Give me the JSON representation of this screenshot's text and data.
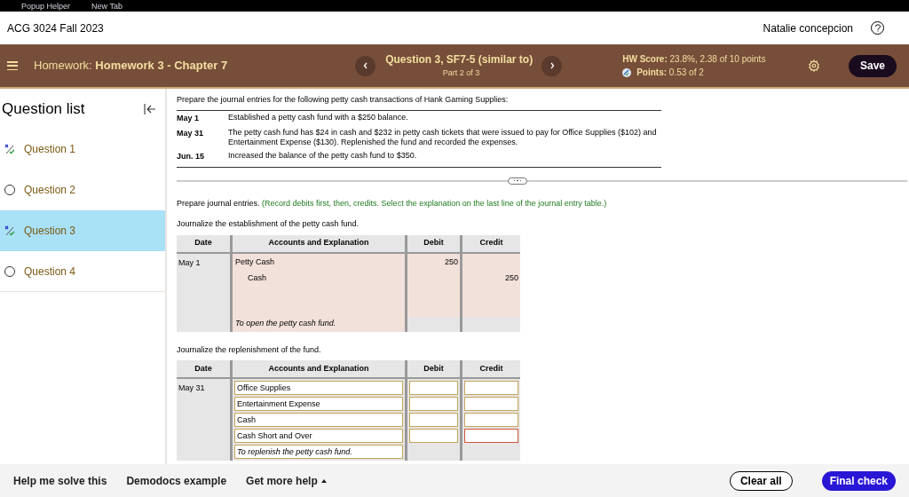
{
  "browser_bookmarks": [
    "Popup Helper",
    "New Tab"
  ],
  "header": {
    "course": "ACG 3024 Fall 2023",
    "user": "Natalie concepcion"
  },
  "toolbar": {
    "homework_label": "Homework:",
    "homework_name": "Homework 3 - Chapter 7",
    "question_title": "Question 3, SF7-5 (similar to)",
    "question_part": "Part 2 of 3",
    "score_label": "HW Score:",
    "score_value": "23.8%, 2.38 of 10 points",
    "points_label": "Points:",
    "points_value": "0.53 of 2",
    "save": "Save"
  },
  "sidebar": {
    "title": "Question list",
    "items": [
      {
        "label": "Question 1",
        "kind": "partial",
        "selected": false
      },
      {
        "label": "Question 2",
        "kind": "unanswered",
        "selected": false
      },
      {
        "label": "Question 3",
        "kind": "partial",
        "selected": true
      },
      {
        "label": "Question 4",
        "kind": "unanswered",
        "selected": false
      }
    ]
  },
  "problem": {
    "intro": "Prepare the journal entries for the following petty cash transactions of Hank Gaming Supplies:",
    "transactions": [
      {
        "date": "May 1",
        "text": "Established a petty cash fund with a $250 balance."
      },
      {
        "date": "May 31",
        "text": "The petty cash fund has $24 in cash and $232 in petty cash tickets that were issued to pay for Office Supplies ($102) and Entertainment Expense ($130). Replenished the fund and recorded the expenses."
      },
      {
        "date": "Jun. 15",
        "text": "Increased the balance of the petty cash fund to $350."
      }
    ]
  },
  "instruction": "Prepare journal entries.",
  "instruction_note": "(Record debits first, then, credits. Select the explanation on the last line of the journal entry table.)",
  "journals": [
    {
      "heading": "Journalize the establishment of the petty cash fund.",
      "columns": [
        "Date",
        "Accounts and Explanation",
        "Debit",
        "Credit"
      ],
      "kind": "answered",
      "date": "May 1",
      "lines": [
        {
          "account": "Petty Cash",
          "kind": "debit",
          "amount": "250"
        },
        {
          "account": "Cash",
          "kind": "credit",
          "amount": "250"
        }
      ],
      "explanation": "To open the petty cash fund."
    },
    {
      "heading": "Journalize the replenishment of the fund.",
      "columns": [
        "Date",
        "Accounts and Explanation",
        "Debit",
        "Credit"
      ],
      "kind": "input",
      "date": "May 31",
      "lines": [
        {
          "account": "Office Supplies",
          "credit_flagged": false
        },
        {
          "account": "Entertainment Expense",
          "credit_flagged": false
        },
        {
          "account": "Cash",
          "credit_flagged": false
        },
        {
          "account": "Cash Short and Over",
          "credit_flagged": true
        }
      ],
      "explanation": "To replenish the petty cash fund."
    }
  ],
  "footer": {
    "links": [
      "Help me solve this",
      "Demodocs example",
      "Get more help"
    ],
    "clear": "Clear all",
    "final": "Final check"
  }
}
